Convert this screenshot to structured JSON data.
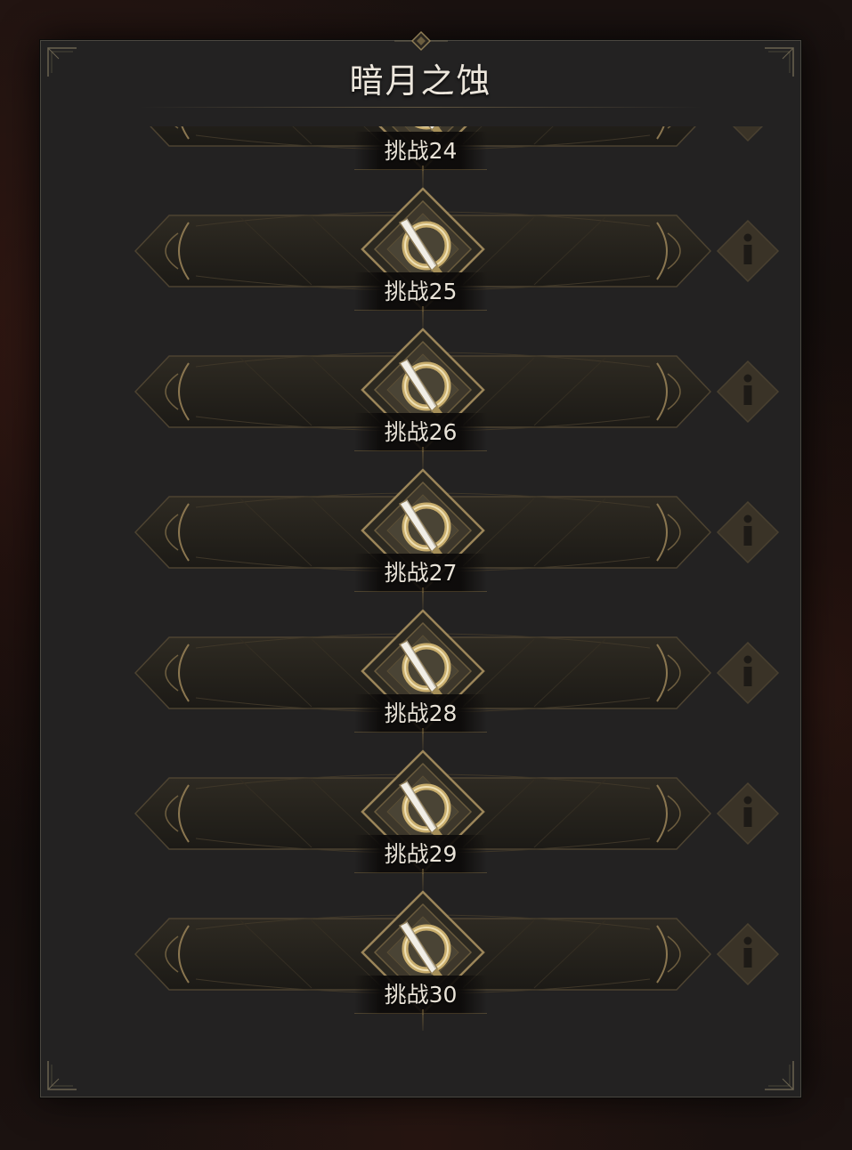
{
  "window": {
    "title": "暗月之蚀"
  },
  "challenges": [
    {
      "label": "挑战24"
    },
    {
      "label": "挑战25"
    },
    {
      "label": "挑战26"
    },
    {
      "label": "挑战27"
    },
    {
      "label": "挑战28"
    },
    {
      "label": "挑战29"
    },
    {
      "label": "挑战30"
    }
  ],
  "icons": {
    "row_emblem": "crossed-sword-crescent-icon",
    "info": "info-icon",
    "panel_corner": "corner-ornament-icon",
    "header_ornament": "diamond-ornament-icon"
  },
  "colors": {
    "panel_bg": "#232222",
    "gold": "#a88d5a",
    "gold_dark": "#5c4a2c",
    "text": "#e9e3d8",
    "info_bg": "#3a3327"
  }
}
